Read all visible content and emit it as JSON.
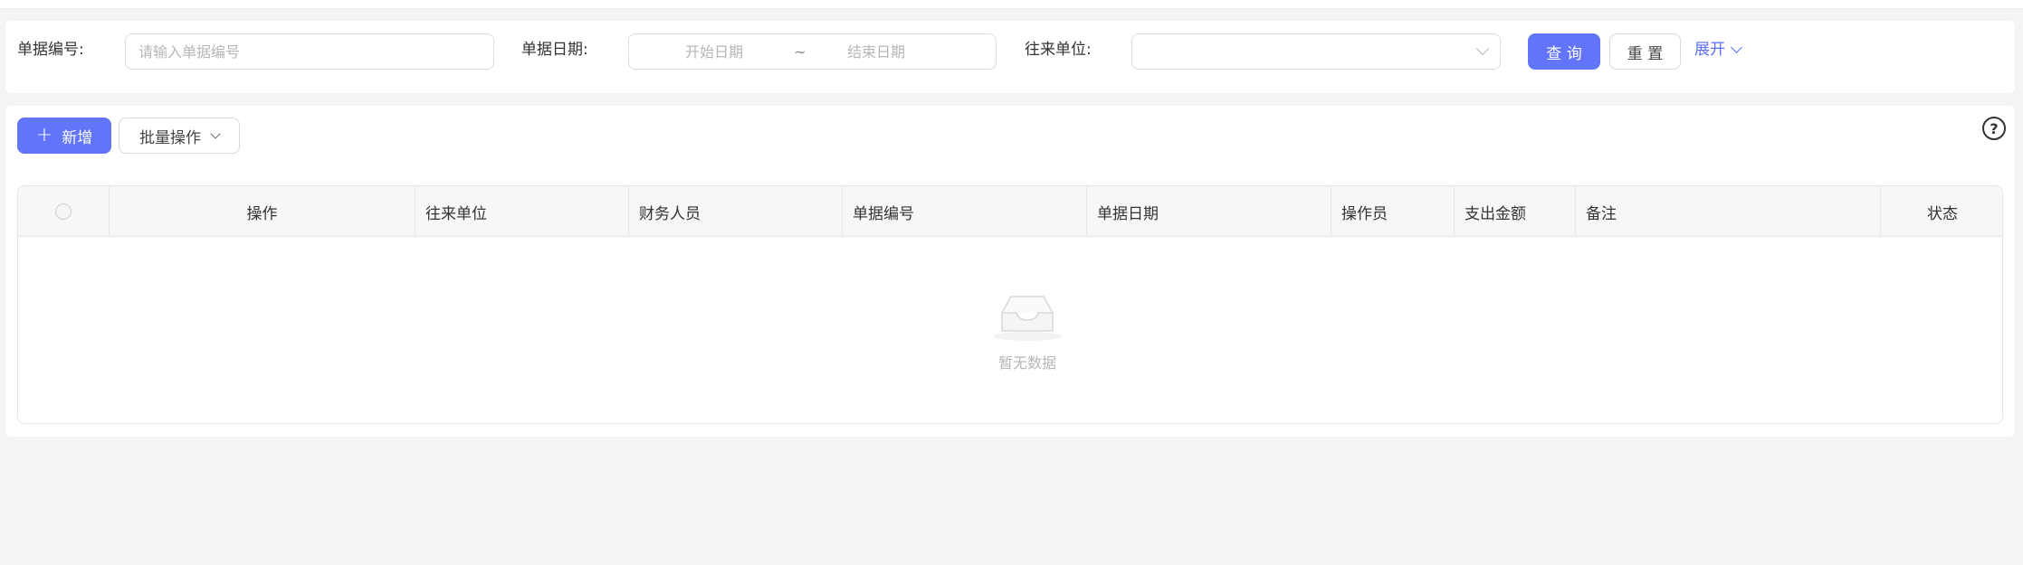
{
  "search": {
    "doc_no_label": "单据编号:",
    "doc_no_placeholder": "请输入单据编号",
    "doc_date_label": "单据日期:",
    "start_date": "开始日期",
    "date_sep": "~",
    "end_date": "结束日期",
    "partner_label": "往来单位:",
    "partner_value": "",
    "query_button": "查 询",
    "reset_button": "重 置",
    "expand_link": "展开"
  },
  "toolbar": {
    "add_button": "新增",
    "batch_button": "批量操作"
  },
  "table": {
    "columns": [
      "操作",
      "往来单位",
      "财务人员",
      "单据编号",
      "单据日期",
      "操作员",
      "支出金额",
      "备注",
      "状态"
    ],
    "empty_text": "暂无数据"
  },
  "colors": {
    "primary": "#6274f7",
    "link": "#5b6ef2",
    "background": "#f5f4f2"
  },
  "icons": {
    "help": "question-circle-icon",
    "empty": "inbox-icon",
    "add": "plus-icon",
    "dropdown": "chevron-down-icon"
  }
}
